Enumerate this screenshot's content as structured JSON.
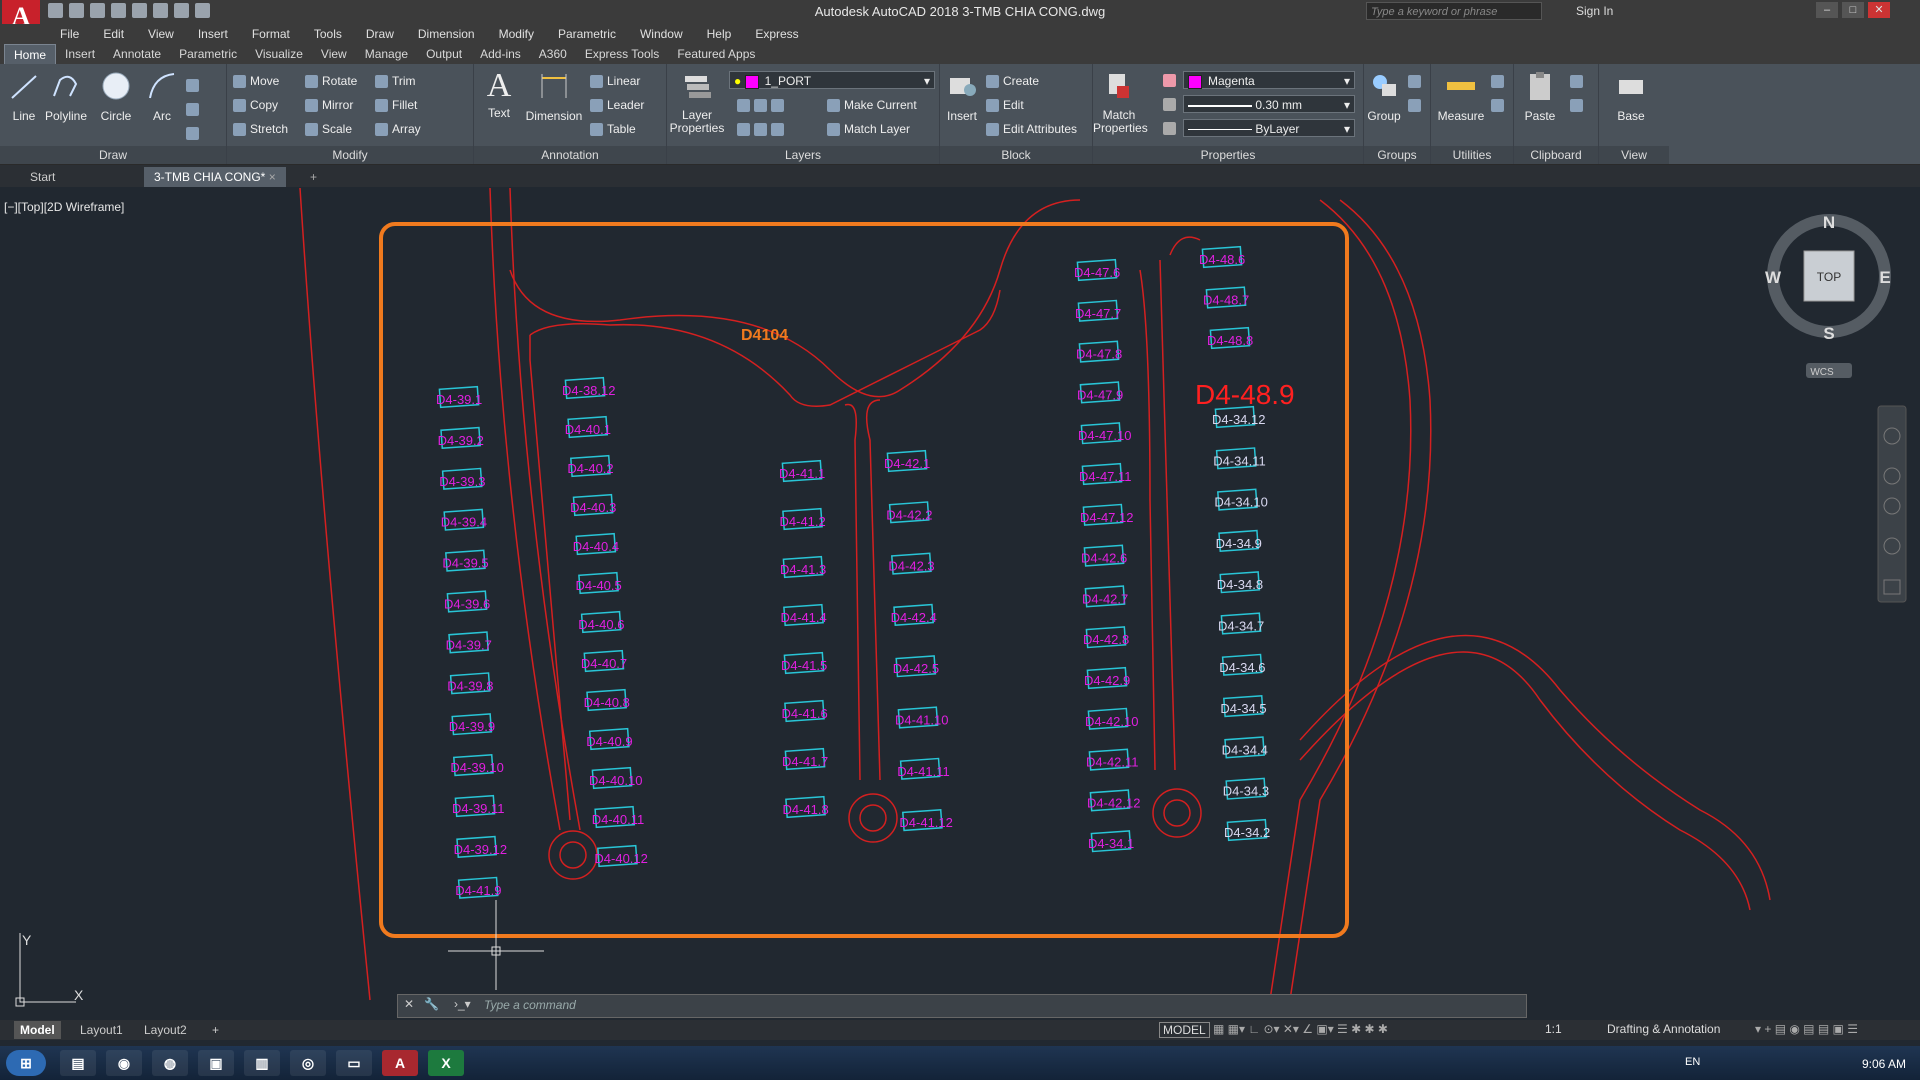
{
  "app": {
    "logo": "A",
    "title": "Autodesk AutoCAD 2018    3-TMB CHIA CONG.dwg",
    "search_placeholder": "Type a keyword or phrase",
    "sign_in": "Sign In"
  },
  "menu": [
    "File",
    "Edit",
    "View",
    "Insert",
    "Format",
    "Tools",
    "Draw",
    "Dimension",
    "Modify",
    "Parametric",
    "Window",
    "Help",
    "Express"
  ],
  "ribbon_tabs": [
    "Home",
    "Insert",
    "Annotate",
    "Parametric",
    "Visualize",
    "View",
    "Manage",
    "Output",
    "Add-ins",
    "A360",
    "Express Tools",
    "Featured Apps"
  ],
  "ribbon": {
    "draw": {
      "title": "Draw",
      "line": "Line",
      "polyline": "Polyline",
      "circle": "Circle",
      "arc": "Arc"
    },
    "modify": {
      "title": "Modify",
      "move": "Move",
      "rotate": "Rotate",
      "trim": "Trim",
      "copy": "Copy",
      "mirror": "Mirror",
      "fillet": "Fillet",
      "stretch": "Stretch",
      "scale": "Scale",
      "array": "Array"
    },
    "annotation": {
      "title": "Annotation",
      "text": "Text",
      "dimension": "Dimension",
      "linear": "Linear",
      "leader": "Leader",
      "table": "Table"
    },
    "layers": {
      "title": "Layers",
      "layer_properties": "Layer Properties",
      "current_layer": "1_PORT",
      "make_current": "Make Current",
      "match_layer": "Match Layer"
    },
    "block": {
      "title": "Block",
      "insert": "Insert",
      "create": "Create",
      "edit": "Edit",
      "edit_attributes": "Edit Attributes"
    },
    "properties": {
      "title": "Properties",
      "match_properties": "Match Properties",
      "color": "Magenta",
      "lineweight": "0.30 mm",
      "linetype": "ByLayer"
    },
    "groups": {
      "title": "Groups",
      "group": "Group"
    },
    "utilities": {
      "title": "Utilities",
      "measure": "Measure"
    },
    "clipboard": {
      "title": "Clipboard",
      "paste": "Paste"
    },
    "view": {
      "title": "View",
      "base": "Base"
    }
  },
  "file_tabs": [
    "Start",
    "3-TMB CHIA CONG*"
  ],
  "viewport_label": "[−][Top][2D Wireframe]",
  "drawing": {
    "block_label": "D4104",
    "highlight_label": "D4-48.9",
    "colors": {
      "boundary": "#f07a1e",
      "road": "#d42020",
      "port": "#29c5d6",
      "port_label": "#e020e0",
      "highlight": "#ff2020"
    },
    "columns": [
      {
        "ports": [
          "D4-39.1",
          "D4-39.2",
          "D4-39.3",
          "D4-39.4",
          "D4-39.5",
          "D4-39.6",
          "D4-39.7",
          "D4-39.8",
          "D4-39.9",
          "D4-39.10",
          "D4-39.11",
          "D4-39.12",
          "D4-41.9"
        ]
      },
      {
        "ports": [
          "D4-38.12",
          "D4-40.1",
          "D4-40.2",
          "D4-40.3",
          "D4-40.4",
          "D4-40.5",
          "D4-40.6",
          "D4-40.7",
          "D4-40.8",
          "D4-40.9",
          "D4-40.10",
          "D4-40.11",
          "D4-40.12"
        ]
      },
      {
        "ports": [
          "D4-41.1",
          "D4-41.2",
          "D4-41.3",
          "D4-41.4",
          "D4-41.5",
          "D4-41.6",
          "D4-41.7",
          "D4-41.8"
        ]
      },
      {
        "ports": [
          "D4-42.1",
          "D4-42.2",
          "D4-42.3",
          "D4-42.4",
          "D4-42.5",
          "D4-41.10",
          "D4-41.11",
          "D4-41.12"
        ]
      },
      {
        "ports": [
          "D4-47.6",
          "D4-47.7",
          "D4-47.8",
          "D4-47.9",
          "D4-47.10",
          "D4-47.11",
          "D4-47.12",
          "D4-42.6",
          "D4-42.7",
          "D4-42.8",
          "D4-42.9",
          "D4-42.10",
          "D4-42.11",
          "D4-42.12",
          "D4-34.1"
        ]
      },
      {
        "ports": [
          "D4-48.6",
          "D4-48.7",
          "D4-48.8"
        ]
      },
      {
        "ports": [
          "D4-34.12",
          "D4-34.11",
          "D4-34.10",
          "D4-34.9",
          "D4-34.8",
          "D4-34.7",
          "D4-34.6",
          "D4-34.5",
          "D4-34.4",
          "D4-34.3",
          "D4-34.2"
        ]
      }
    ]
  },
  "viewcube": {
    "n": "N",
    "s": "S",
    "e": "E",
    "w": "W",
    "top": "TOP",
    "wcs": "WCS"
  },
  "ucs": {
    "x": "X",
    "y": "Y"
  },
  "command_line": {
    "placeholder": "Type  a  command"
  },
  "layout_tabs": [
    "Model",
    "Layout1",
    "Layout2"
  ],
  "status": {
    "model": "MODEL",
    "scale": "1:1",
    "workspace": "Drafting & Annotation"
  },
  "taskbar": {
    "lang": "EN",
    "time": "9:06 AM"
  }
}
